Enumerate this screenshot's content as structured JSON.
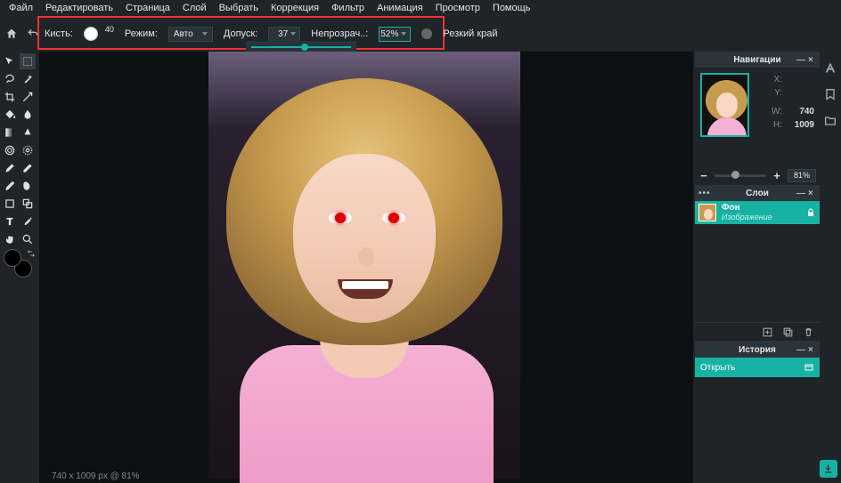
{
  "menu": {
    "items": [
      "Файл",
      "Редактировать",
      "Страница",
      "Слой",
      "Выбрать",
      "Коррекция",
      "Фильтр",
      "Анимация",
      "Просмотр",
      "Помощь"
    ]
  },
  "options": {
    "brush_label": "Кисть:",
    "brush_size": "40",
    "mode_label": "Режим:",
    "mode_value": "Авто",
    "tolerance_label": "Допуск:",
    "tolerance_value": "37",
    "opacity_label": "Непрозрач..:",
    "opacity_value": "52%",
    "hard_edge_label": "Резкий край",
    "opacity_slider_pct": 52
  },
  "panels": {
    "navigation": {
      "title": "Навигации",
      "x_label": "X:",
      "y_label": "Y:",
      "w_label": "W:",
      "h_label": "H:",
      "x": "",
      "y": "",
      "w": "740",
      "h": "1009",
      "zoom": "81%"
    },
    "layers": {
      "title": "Слои",
      "items": [
        {
          "name": "Фон",
          "type": "Изображение",
          "locked": true
        }
      ]
    },
    "history": {
      "title": "История",
      "items": [
        "Открыть"
      ]
    }
  },
  "status": {
    "text": "740 x 1009 px @ 81%"
  },
  "colors": {
    "fg": "#000000",
    "bg": "#000000",
    "accent": "#17b2a4",
    "highlight": "#e33"
  }
}
